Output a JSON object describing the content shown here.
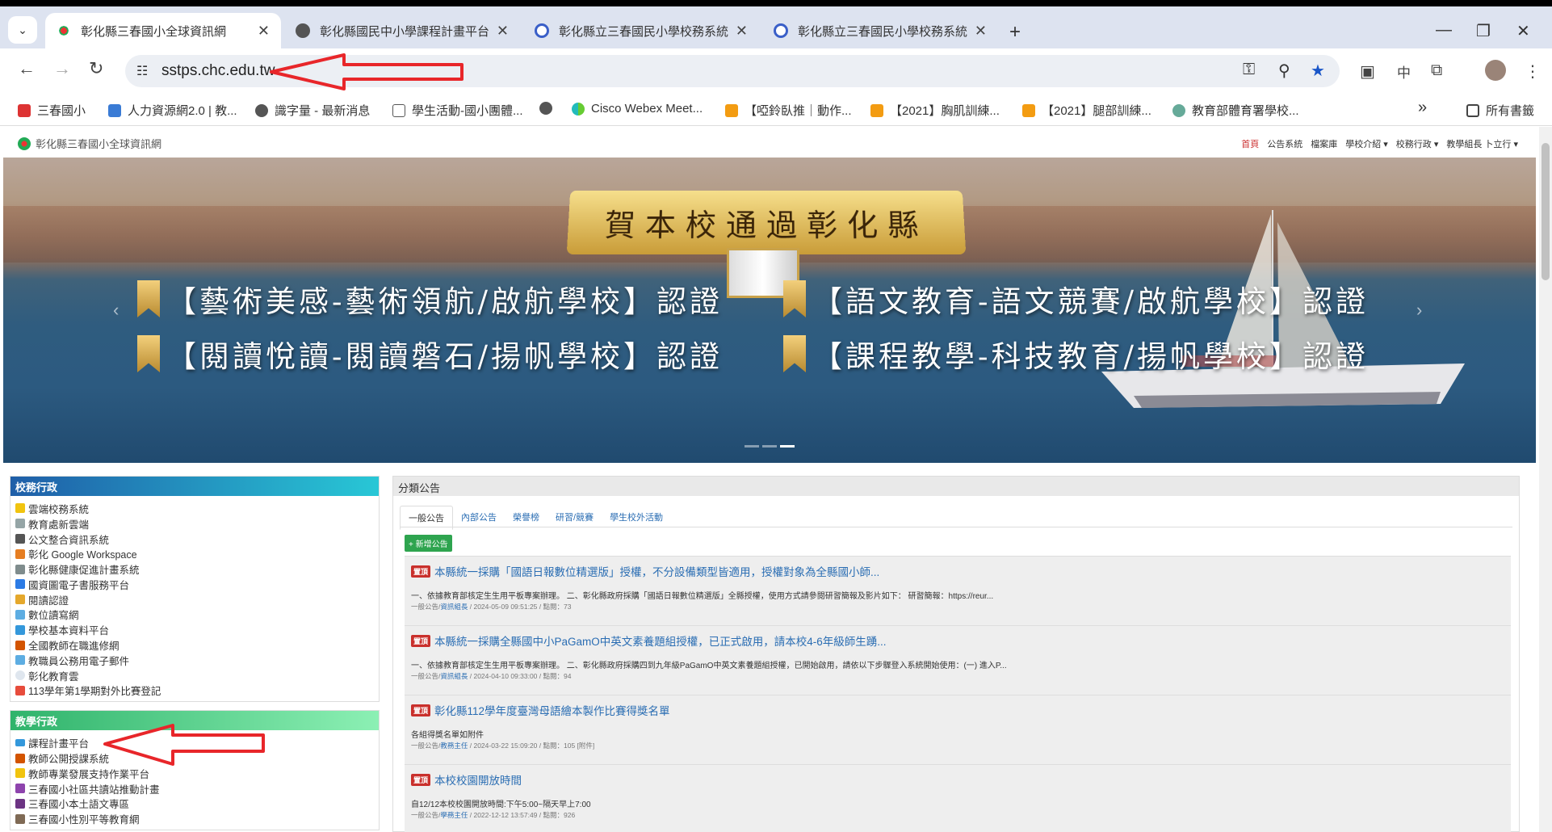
{
  "browser": {
    "tabs": [
      {
        "title": "彰化縣三春國小全球資訊網",
        "active": true
      },
      {
        "title": "彰化縣國民中小學課程計畫平台",
        "active": false
      },
      {
        "title": "彰化縣立三春國民小學校務系統",
        "active": false
      },
      {
        "title": "彰化縣立三春國民小學校務系統",
        "active": false
      }
    ],
    "url": "sstps.chc.edu.tw",
    "lang_indicator": "中",
    "bookmarks": [
      "三春國小",
      "人力資源網2.0 | 教...",
      "識字量 - 最新消息",
      "學生活動-國小團體...",
      "",
      "Cisco Webex Meet...",
      "【啞鈴臥推｜動作...",
      "【2021】胸肌訓練...",
      "【2021】腿部訓練...",
      "教育部體育署學校...",
      "所有書籤"
    ]
  },
  "site": {
    "brand": "彰化縣三春國小全球資訊網",
    "nav": [
      "首頁",
      "公告系統",
      "檔案庫",
      "學校介紹 ▾",
      "校務行政 ▾",
      "教學組長 卜立行 ▾"
    ],
    "banner": {
      "ribbon": "賀本校通過彰化縣",
      "lines": [
        "【藝術美感-藝術領航/啟航學校】認證",
        "【語文教育-語文競賽/啟航學校】認證",
        "【閱讀悅讀-閱讀磐石/揚帆學校】認證",
        "【課程教學-科技教育/揚帆學校】認證"
      ]
    },
    "admin_panel": {
      "title": "校務行政",
      "items": [
        "雲端校務系統",
        "教育處新雲端",
        "公文整合資訊系統",
        "彰化 Google Workspace",
        "彰化縣健康促進計畫系統",
        "國資圖電子書服務平台",
        "閱讀認證",
        "數位讀寫網",
        "學校基本資料平台",
        "全國教師在職進修網",
        "教職員公務用電子郵件",
        "彰化教育雲",
        "113學年第1學期對外比賽登記"
      ]
    },
    "teaching_panel": {
      "title": "教學行政",
      "items": [
        "課程計畫平台",
        "教師公開授課系統",
        "教師專業發展支持作業平台",
        "三春國小社區共讀站推動計畫",
        "三春國小本土語文專區",
        "三春國小性別平等教育網"
      ]
    },
    "announcements": {
      "title": "分類公告",
      "tabs": [
        "一般公告",
        "內部公告",
        "榮譽榜",
        "研習/競賽",
        "學生校外活動"
      ],
      "add_label": "+ 新增公告",
      "tag": "置頂",
      "items": [
        {
          "title": "本縣統一採購「國語日報數位精選版」授權，不分設備類型皆適用，授權對象為全縣國小師...",
          "desc": "一、依據教育部核定生生用平板專案辦理。 二、彰化縣政府採購「國語日報數位精選版」全縣授權，使用方式請參閱研習簡報及影片如下： 研習簡報：https://reur...",
          "meta_prefix": "一般公告/",
          "meta_author": "資訊組長",
          "meta_suffix": " / 2024-05-09 09:51:25 / 點閱：73"
        },
        {
          "title": "本縣統一採購全縣國中小PaGamO中英文素養題組授權，已正式啟用，請本校4-6年級師生踴...",
          "desc": "一、依據教育部核定生生用平板專案辦理。 二、彰化縣政府採購四到九年級PaGamO中英文素養題組授權，已開始啟用，請依以下步驟登入系統開始使用：(一) 進入P...",
          "meta_prefix": "一般公告/",
          "meta_author": "資訊組長",
          "meta_suffix": " / 2024-04-10 09:33:00 / 點閱：94"
        },
        {
          "title": "彰化縣112學年度臺灣母語繪本製作比賽得獎名單",
          "desc": "各組得獎名單如附件",
          "meta_prefix": "一般公告/",
          "meta_author": "教務主任",
          "meta_suffix": " / 2024-03-22 15:09:20 / 點閱：105 [附件]"
        },
        {
          "title": "本校校園開放時間",
          "desc": "自12/12本校校園開放時間:下午5:00~隔天早上7:00",
          "meta_prefix": "一般公告/",
          "meta_author": "學務主任",
          "meta_suffix": " / 2022-12-12 13:57:49 / 點閱：926"
        }
      ]
    }
  },
  "colors": {
    "arrow": "#e8262a",
    "admin_header": "#1f5ea8",
    "teaching_header": "#2fb36b",
    "link": "#2a6db3",
    "tag": "#c9302c"
  }
}
